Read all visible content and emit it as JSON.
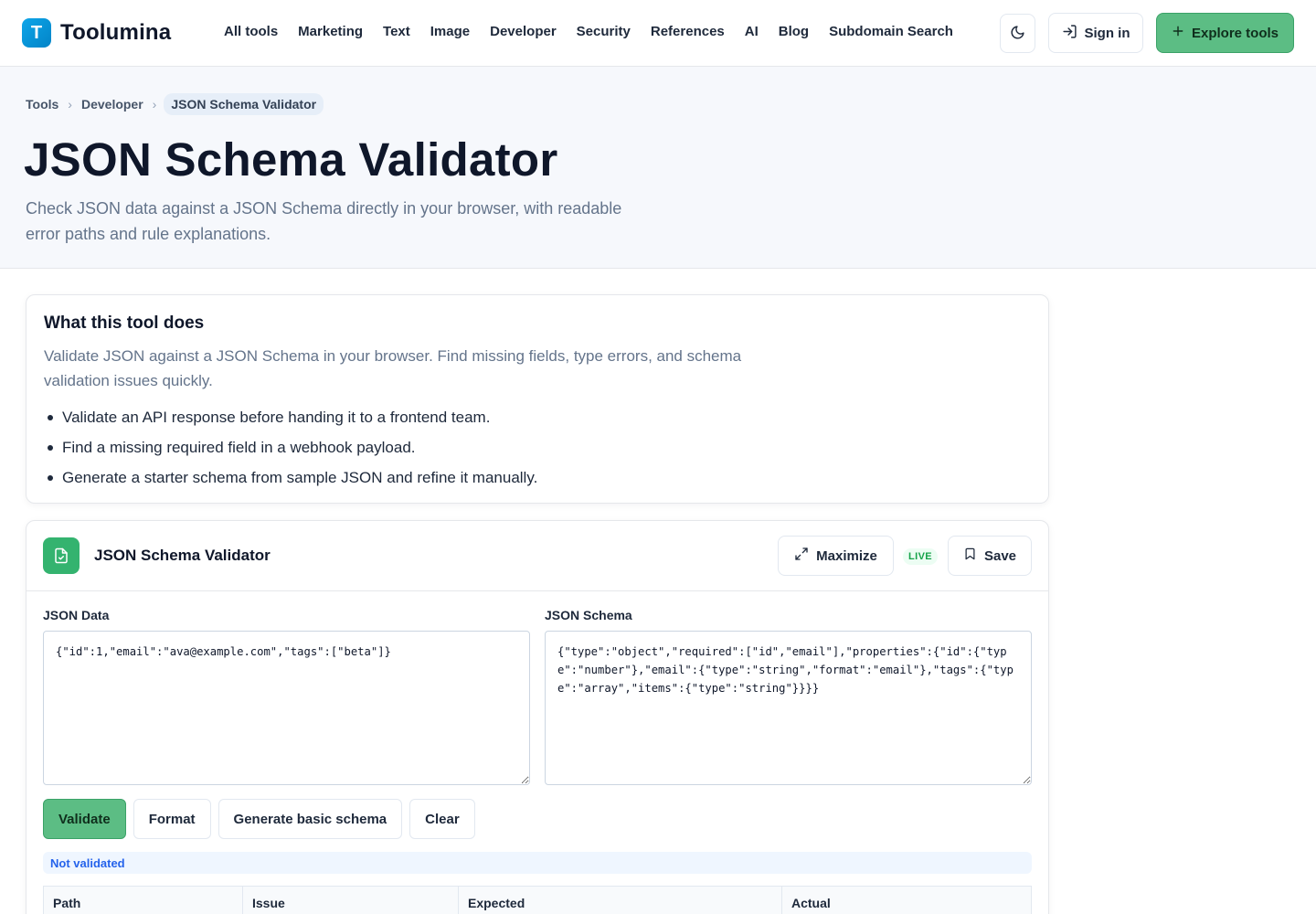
{
  "brand": {
    "logo_letter": "T",
    "name": "Toolumina"
  },
  "nav": {
    "items": [
      "All tools",
      "Marketing",
      "Text",
      "Image",
      "Developer",
      "Security",
      "References",
      "AI",
      "Blog",
      "Subdomain Search"
    ]
  },
  "header_actions": {
    "theme_icon": "moon-icon",
    "signin_label": "Sign in",
    "explore_label": "Explore tools"
  },
  "breadcrumb": {
    "items": [
      "Tools",
      "Developer"
    ],
    "current": "JSON Schema Validator"
  },
  "hero": {
    "title": "JSON Schema Validator",
    "subtitle": "Check JSON data against a JSON Schema directly in your browser, with readable error paths and rule explanations."
  },
  "about": {
    "title": "What this tool does",
    "description": "Validate JSON against a JSON Schema in your browser. Find missing fields, type errors, and schema validation issues quickly.",
    "bullets": [
      "Validate an API response before handing it to a frontend team.",
      "Find a missing required field in a webhook payload.",
      "Generate a starter schema from sample JSON and refine it manually."
    ]
  },
  "tool": {
    "name": "JSON Schema Validator",
    "maximize_label": "Maximize",
    "live_badge": "LIVE",
    "save_label": "Save",
    "data_label": "JSON Data",
    "data_value": "{\"id\":1,\"email\":\"ava@example.com\",\"tags\":[\"beta\"]}",
    "schema_label": "JSON Schema",
    "schema_value": "{\"type\":\"object\",\"required\":[\"id\",\"email\"],\"properties\":{\"id\":{\"type\":\"number\"},\"email\":{\"type\":\"string\",\"format\":\"email\"},\"tags\":{\"type\":\"array\",\"items\":{\"type\":\"string\"}}}}",
    "buttons": {
      "validate": "Validate",
      "format": "Format",
      "generate": "Generate basic schema",
      "clear": "Clear"
    },
    "status": "Not validated",
    "table_headers": [
      "Path",
      "Issue",
      "Expected",
      "Actual"
    ]
  },
  "colors": {
    "accent": "#5cbd84",
    "status_blue": "#2563eb",
    "live_green": "#16a34a"
  }
}
